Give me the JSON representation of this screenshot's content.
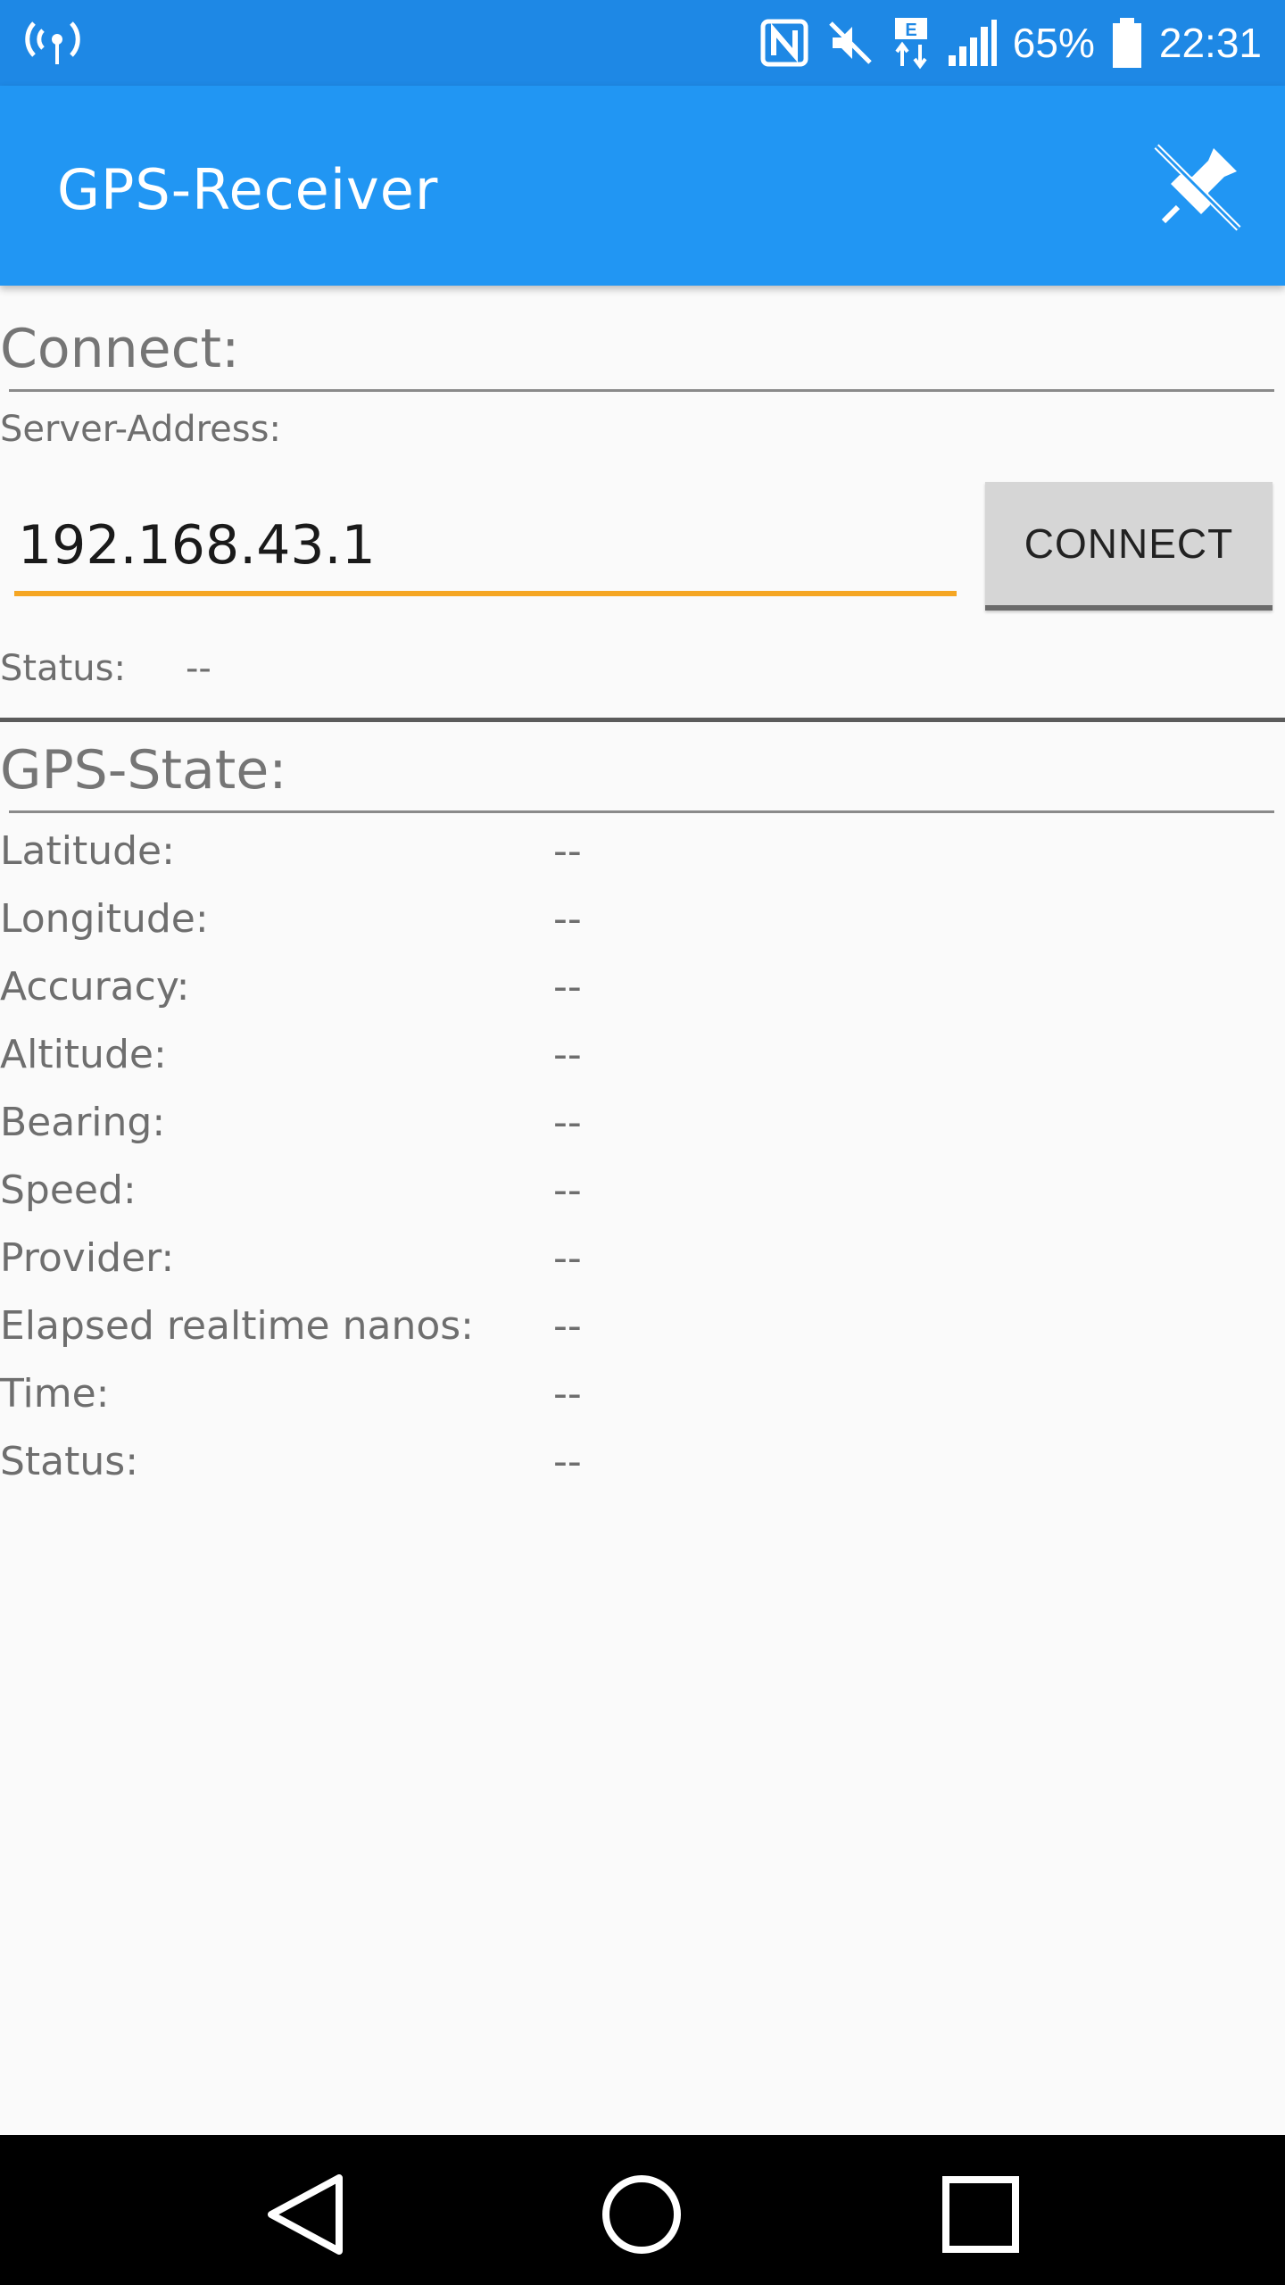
{
  "status_bar": {
    "battery": "65%",
    "time": "22:31"
  },
  "app_bar": {
    "title": "GPS-Receiver",
    "pin_icon": "pin-off-icon"
  },
  "connect": {
    "section_title": "Connect:",
    "server_label": "Server-Address:",
    "server_value": "192.168.43.1",
    "button_label": "CONNECT",
    "status_label": "Status:",
    "status_value": "--"
  },
  "gps": {
    "section_title": "GPS-State:",
    "rows": [
      {
        "label": "Latitude:",
        "value": "--"
      },
      {
        "label": "Longitude:",
        "value": "--"
      },
      {
        "label": "Accuracy:",
        "value": "--"
      },
      {
        "label": "Altitude:",
        "value": "--"
      },
      {
        "label": "Bearing:",
        "value": "--"
      },
      {
        "label": "Speed:",
        "value": "--"
      },
      {
        "label": "Provider:",
        "value": "--"
      },
      {
        "label": "Elapsed realtime nanos:",
        "value": "--"
      },
      {
        "label": "Time:",
        "value": "--"
      },
      {
        "label": "Status:",
        "value": "--"
      }
    ]
  },
  "colors": {
    "status_bar": "#1e88e5",
    "app_bar": "#2196f3",
    "input_accent": "#f5a623"
  },
  "nav": {
    "back_icon": "back-triangle-icon",
    "home_icon": "home-circle-icon",
    "recents_icon": "recents-square-icon"
  }
}
